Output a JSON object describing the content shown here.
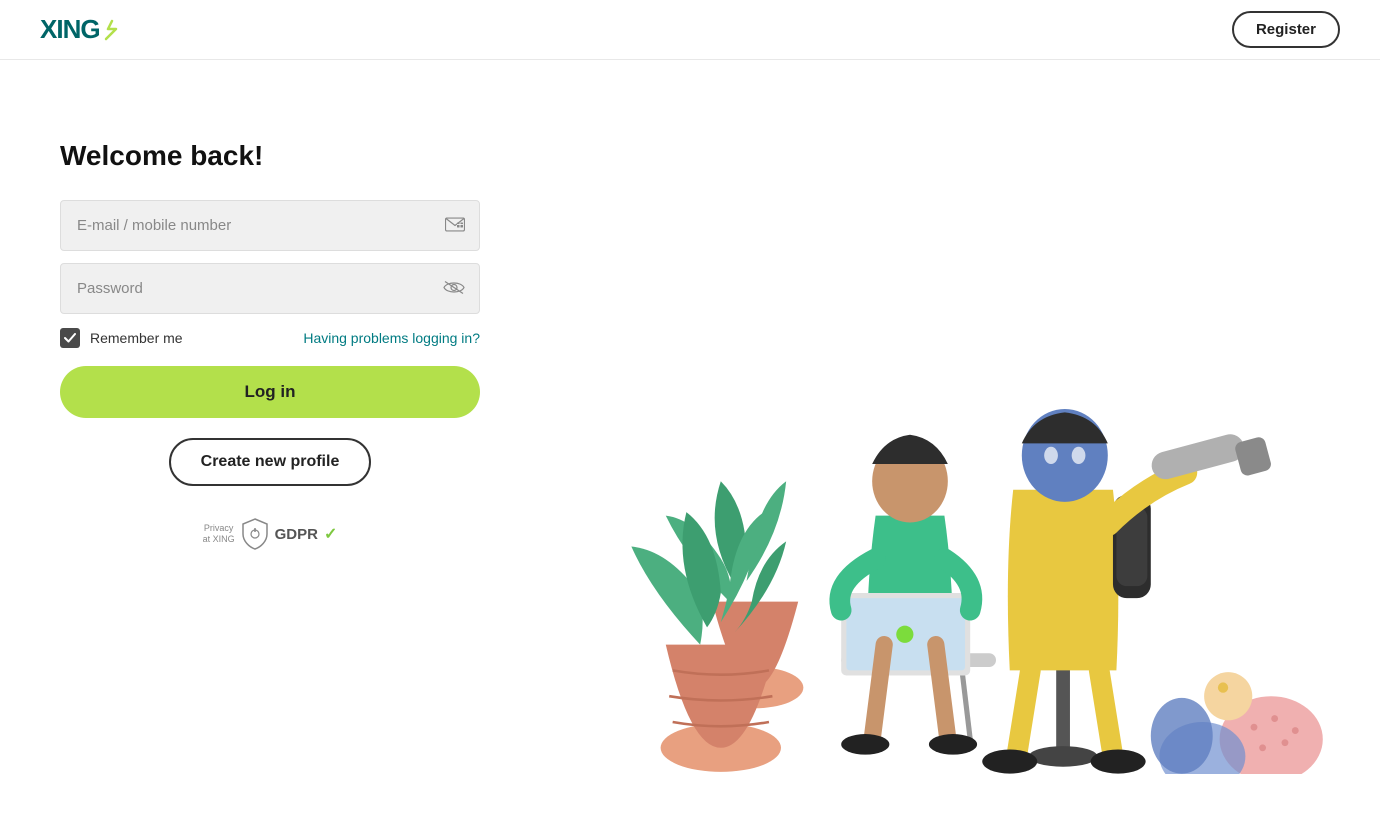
{
  "header": {
    "logo_text": "XING",
    "register_label": "Register"
  },
  "form": {
    "welcome_title": "Welcome back!",
    "email_placeholder": "E-mail / mobile number",
    "password_placeholder": "Password",
    "remember_label": "Remember me",
    "problems_label": "Having problems logging in?",
    "login_label": "Log in",
    "create_profile_label": "Create new profile"
  },
  "gdpr": {
    "privacy_line1": "Privacy",
    "privacy_line2": "at XING",
    "gdpr_label": "GDPR"
  },
  "icons": {
    "email_icon": "⊞",
    "password_icon": "👁",
    "checkmark": "✓"
  }
}
